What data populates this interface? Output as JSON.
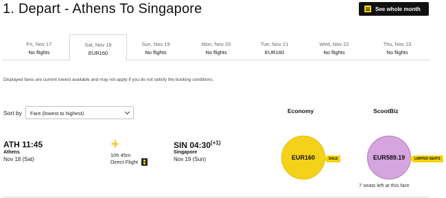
{
  "header": {
    "title": "1. Depart - Athens To Singapore",
    "whole_month_label": "See whole month"
  },
  "date_tabs": [
    {
      "date": "Fri, Nov 17",
      "fare": "No flights",
      "active": false
    },
    {
      "date": "Sat, Nov 18",
      "fare": "EUR160",
      "active": true
    },
    {
      "date": "Sun, Nov 19",
      "fare": "No flights",
      "active": false
    },
    {
      "date": "Mon, Nov 20",
      "fare": "No flights",
      "active": false
    },
    {
      "date": "Tue, Nov 21",
      "fare": "EUR160",
      "active": false
    },
    {
      "date": "Wed, Nov 22",
      "fare": "No flights",
      "active": false
    },
    {
      "date": "Thu, Nov 23",
      "fare": "No flights",
      "active": false
    }
  ],
  "disclaimer": "Displayed fares are current lowest available and may not apply if you do not satisfy the booking conditions.",
  "sort": {
    "label": "Sort by",
    "selected": "Fare (lowest to highest)"
  },
  "columns": {
    "economy": "Economy",
    "scootbiz": "ScootBiz"
  },
  "flight": {
    "departure": {
      "time": "ATH 11:45",
      "city": "Athens",
      "date": "Nov 18 (Sat)"
    },
    "arrival": {
      "time": "SIN 04:30",
      "day_offset": "(+1)",
      "city": "Singapore",
      "date": "Nov 19 (Sun)"
    },
    "duration": "10h 45m",
    "type": "Direct Flight"
  },
  "fares": {
    "economy": {
      "price": "EUR160",
      "tag": "SALE"
    },
    "scootbiz": {
      "price": "EUR589.19",
      "tag": "LIMITED SEATS",
      "seats_note": "7 seats left at this fare"
    }
  },
  "colors": {
    "brand_yellow": "#f5d21a",
    "biz_purple": "#d6a4de",
    "dark": "#111111"
  }
}
